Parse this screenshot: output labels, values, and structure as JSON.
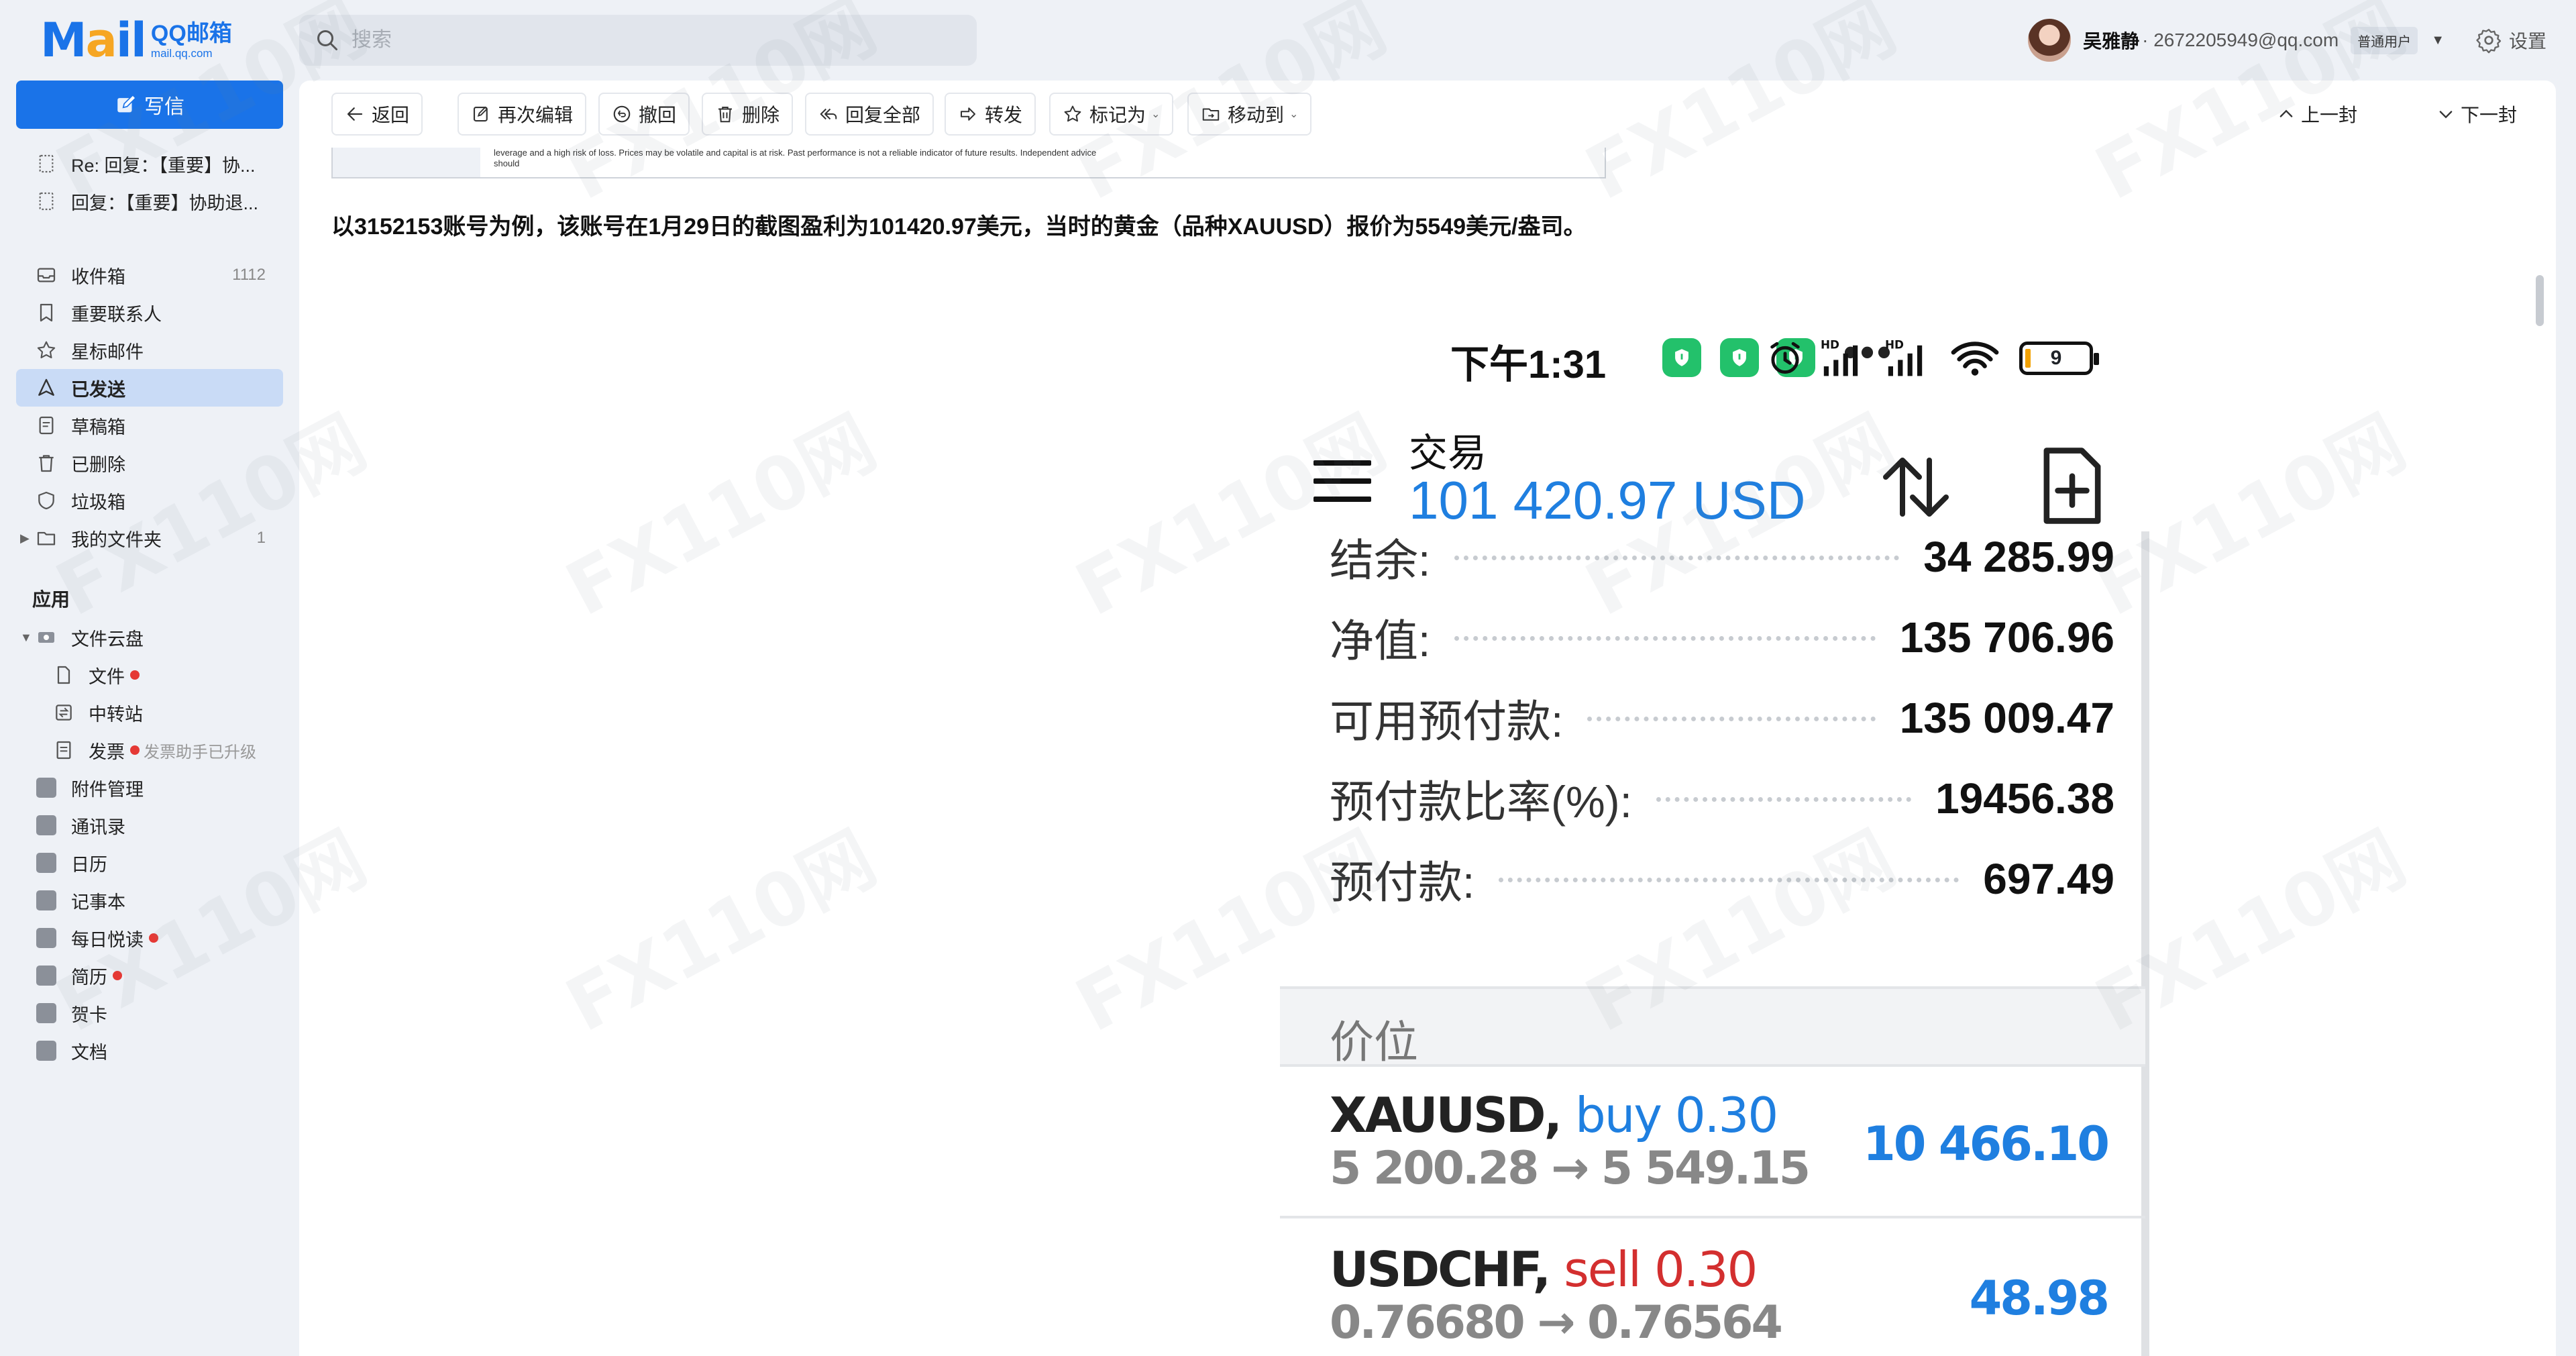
{
  "app": {
    "logo_main": "Mail",
    "logo_brand": "QQ邮箱",
    "logo_domain": "mail.qq.com"
  },
  "search": {
    "placeholder": "搜索"
  },
  "user": {
    "name": "吴雅静",
    "email": "· 2672205949@qq.com",
    "badge": "普通用户",
    "settings_label": "设置"
  },
  "sidebar": {
    "compose_label": "写信",
    "drafts_recent": [
      {
        "label": "Re: 回复：【重要】协..."
      },
      {
        "label": "回复：【重要】协助退..."
      }
    ],
    "folders": [
      {
        "label": "收件箱",
        "count": "1112"
      },
      {
        "label": "重要联系人"
      },
      {
        "label": "星标邮件"
      },
      {
        "label": "已发送"
      },
      {
        "label": "草稿箱"
      },
      {
        "label": "已删除"
      },
      {
        "label": "垃圾箱"
      },
      {
        "label": "我的文件夹",
        "count": "1"
      }
    ],
    "apps_title": "应用",
    "apps": [
      {
        "label": "文件云盘"
      },
      {
        "label": "文件"
      },
      {
        "label": "中转站"
      },
      {
        "label": "发票",
        "note": "发票助手已升级"
      },
      {
        "label": "附件管理"
      },
      {
        "label": "通讯录"
      },
      {
        "label": "日历"
      },
      {
        "label": "记事本"
      },
      {
        "label": "每日悦读"
      },
      {
        "label": "简历"
      },
      {
        "label": "贺卡"
      },
      {
        "label": "文档"
      }
    ]
  },
  "toolbar": {
    "back": "返回",
    "reedit": "再次编辑",
    "recall": "撤回",
    "delete": "删除",
    "reply_all": "回复全部",
    "forward": "转发",
    "mark_as": "标记为",
    "move_to": "移动到",
    "prev": "上一封",
    "next": "下一封"
  },
  "email": {
    "prev_image_text": "leverage and a high risk of loss. Prices may be volatile and capital is at risk. Past performance is not a reliable indicator of future results. Independent advice should",
    "intro": "以3152153账号为例，该账号在1月29日的截图盈利为101420.97美元，当时的黄金（品种XAUUSD）报价为5549美元/盎司。"
  },
  "phone": {
    "time": "下午1:31",
    "more": "•••",
    "battery": "9",
    "title": "交易",
    "profit_total": "101 420.97 USD",
    "account": [
      {
        "label": "结余:",
        "value": "34 285.99"
      },
      {
        "label": "净值:",
        "value": "135 706.96"
      },
      {
        "label": "可用预付款:",
        "value": "135 009.47"
      },
      {
        "label": "预付款比率(%):",
        "value": "19456.38"
      },
      {
        "label": "预付款:",
        "value": "697.49"
      }
    ],
    "prices_header": "价位",
    "positions": [
      {
        "symbol": "XAUUSD,",
        "side": "buy 0.30",
        "range": "5 200.28 → 5 549.15",
        "profit": "10 466.10"
      },
      {
        "symbol": "USDCHF,",
        "side": "sell 0.30",
        "range": "0.76680 → 0.76564",
        "profit": "48.98"
      }
    ]
  },
  "watermark": "FX110网",
  "colors": {
    "accent": "#1a73e8",
    "sidebar_active": "#c9dbf6",
    "profit_blue": "#1f7fe0",
    "sell_red": "#d32f2f"
  }
}
